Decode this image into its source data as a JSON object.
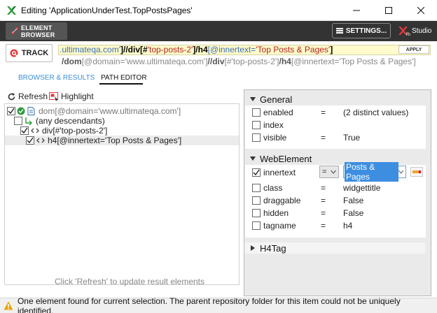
{
  "window": {
    "title": "Editing 'ApplicationUnderTest.TopPostsPages'",
    "icon": "ranorex-x-icon"
  },
  "toolbar": {
    "element_browser_label": "ELEMENT BROWSER",
    "settings_label": "SETTINGS...",
    "studio_label": "Studio"
  },
  "track": {
    "label": "TRACK"
  },
  "path": {
    "main": {
      "seg1": ".ultimateqa.com'",
      "seg2": "]//",
      "seg3": "div",
      "seg4": "[#",
      "seg5": "'top-posts-2'",
      "seg6": "]/",
      "seg7": "h4",
      "seg8": "[@innertext=",
      "seg9": "'Top Posts & Pages'",
      "seg10": "]"
    },
    "apply_label": "APPLY",
    "secondary": {
      "s1": "/",
      "s2": "dom",
      "s3": "[@domain='www.ultimateqa.com']",
      "s4": "//",
      "s5": "div",
      "s6": "[#'top-posts-2']",
      "s7": "/",
      "s8": "h4",
      "s9": "[@innertext='Top Posts & Pages']"
    }
  },
  "tabs": {
    "browser": "BROWSER & RESULTS",
    "path_editor": "PATH EDITOR"
  },
  "left": {
    "refresh_label": "Refresh",
    "highlight_label": "Highlight",
    "tree": [
      {
        "label": "dom[@domain='www.ultimateqa.com']",
        "checked": true
      },
      {
        "label": "(any descendants)",
        "checked": false
      },
      {
        "label": "div[#'top-posts-2']",
        "checked": true
      },
      {
        "label": "h4[@innertext='Top Posts & Pages']",
        "checked": true
      }
    ],
    "hint": "Click 'Refresh' to update result elements"
  },
  "right": {
    "general": {
      "header": "General",
      "rows": [
        {
          "name": "enabled",
          "op": "=",
          "value": "(2 distinct values)",
          "checked": false
        },
        {
          "name": "index",
          "op": "",
          "value": "",
          "checked": false
        },
        {
          "name": "visible",
          "op": "=",
          "value": "True",
          "checked": false
        }
      ]
    },
    "webelement": {
      "header": "WebElement",
      "innertext": {
        "name": "innertext",
        "op": "=",
        "value": "Posts & Pages",
        "checked": true
      },
      "rows": [
        {
          "name": "class",
          "op": "=",
          "value": "widgettitle",
          "checked": false
        },
        {
          "name": "draggable",
          "op": "=",
          "value": "False",
          "checked": false
        },
        {
          "name": "hidden",
          "op": "=",
          "value": "False",
          "checked": false
        },
        {
          "name": "tagname",
          "op": "=",
          "value": "h4",
          "checked": false
        }
      ]
    },
    "h4tag": {
      "header": "H4Tag"
    }
  },
  "status": {
    "message": "One element found for current selection. The parent repository folder for this item could not be uniquely identified."
  },
  "colors": {
    "accent": "#3a8fd8",
    "toolbar_bg": "#333333",
    "path_bg": "#fffbcc",
    "selection": "#3d8ee0",
    "warning": "#e8a400"
  }
}
